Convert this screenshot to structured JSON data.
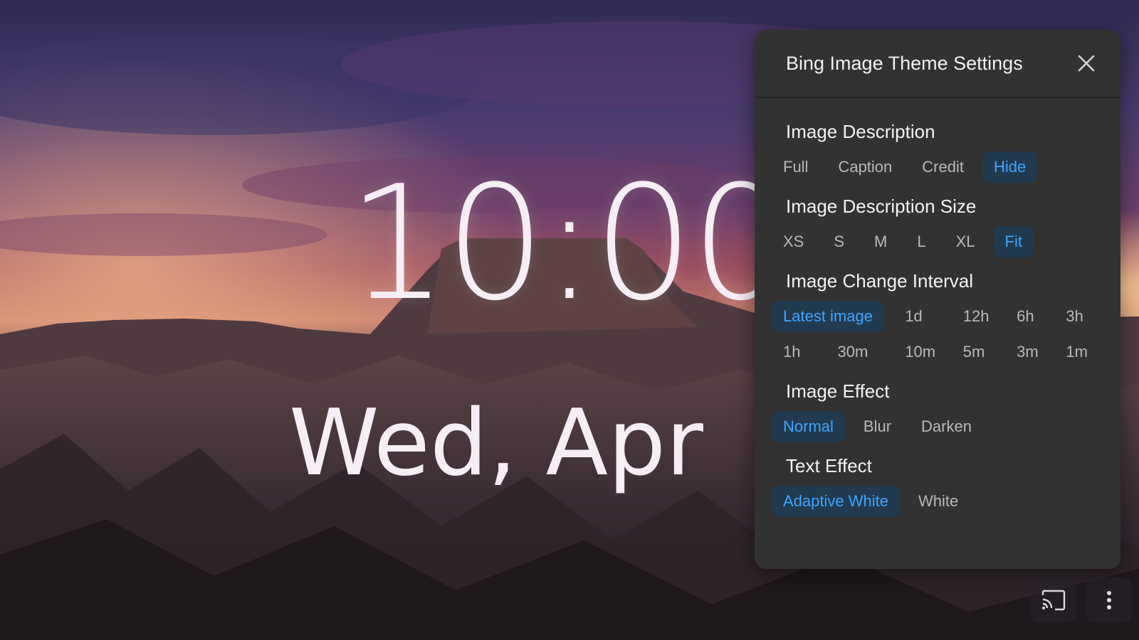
{
  "clock": {
    "time": "10:00",
    "date": "Wed, Apr"
  },
  "panel": {
    "title": "Bing Image Theme Settings",
    "close_icon": "close-icon",
    "sections": [
      {
        "title": "Image Description",
        "options": [
          "Full",
          "Caption",
          "Credit",
          "Hide"
        ],
        "selected": "Hide"
      },
      {
        "title": "Image Description Size",
        "options": [
          "XS",
          "S",
          "M",
          "L",
          "XL",
          "Fit"
        ],
        "selected": "Fit"
      },
      {
        "title": "Image Change Interval",
        "options": [
          "Latest image",
          "1d",
          "12h",
          "6h",
          "3h",
          "1h",
          "30m",
          "10m",
          "5m",
          "3m",
          "1m"
        ],
        "selected": "Latest image"
      },
      {
        "title": "Image Effect",
        "options": [
          "Normal",
          "Blur",
          "Darken"
        ],
        "selected": "Normal"
      },
      {
        "title": "Text Effect",
        "options": [
          "Adaptive White",
          "White"
        ],
        "selected": "Adaptive White"
      }
    ]
  },
  "corner": {
    "cast_icon": "cast-icon",
    "more_icon": "more-vertical-icon"
  },
  "colors": {
    "accent": "#3fa3ff",
    "active_bg": "#213a4f",
    "panel_bg": "#323232"
  }
}
